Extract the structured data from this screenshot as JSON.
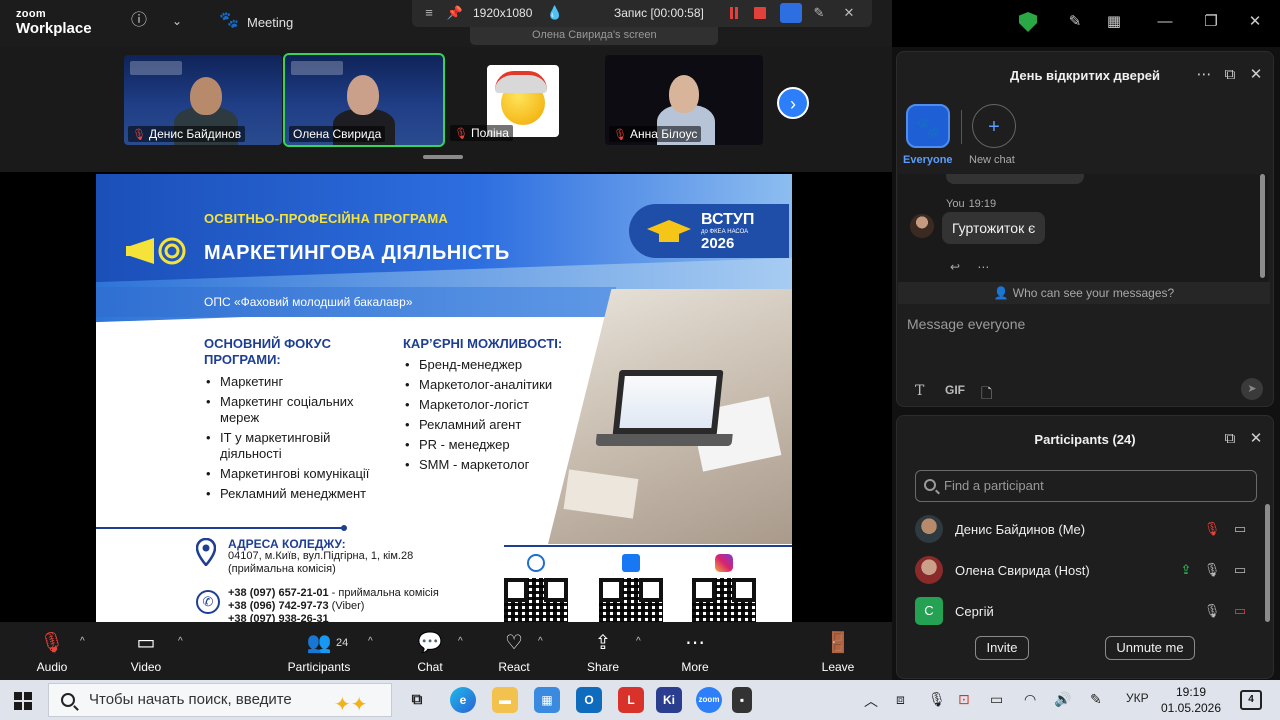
{
  "app": {
    "logo_line1": "zoom",
    "logo_line2": "Workplace",
    "meeting_label": "Meeting"
  },
  "recording_bar": {
    "resolution": "1920x1080",
    "recording": "Запис [00:00:58]",
    "sub_title": "Олена Свирида's screen"
  },
  "video_strip": {
    "participants": [
      {
        "name": "Денис Байдинов",
        "muted": true
      },
      {
        "name": "Олена Свирида",
        "muted": false,
        "active": true
      },
      {
        "name": "Поліна",
        "muted": true
      },
      {
        "name": "Анна Білоус",
        "muted": true
      }
    ]
  },
  "slide": {
    "program": "ОСВІТНЬО-ПРОФЕСІЙНА ПРОГРАМА",
    "title": "МАРКЕТИНГОВА ДІЯЛЬНІСТЬ",
    "vstup_title": "ВСТУП",
    "vstup_sub": "до ФКЕА НАСОА",
    "vstup_year": "2026",
    "ops": "ОПС «Фаховий молодший бакалавр»",
    "focus_heading": "ОСНОВНИЙ ФОКУС ПРОГРАМИ:",
    "focus_items": [
      "Маркетинг",
      "Маркетинг соціальних мереж",
      "ІТ у маркетинговій діяльності",
      "Маркетингові комунікації",
      "Рекламний менеджмент"
    ],
    "career_heading": "КАР’ЄРНІ МОЖЛИВОСТІ:",
    "career_items": [
      "Бренд-менеджер",
      "Маркетолог-аналітики",
      "Маркетолог-логіст",
      "Рекламний агент",
      "PR - менеджер",
      "SMM - маркетолог"
    ],
    "address_heading": "АДРЕСА КОЛЕДЖУ:",
    "address": "04107, м.Київ, вул.Підгірна, 1, кім.28 (приймальна комісія)",
    "phones": [
      {
        "number": "+38 (097) 657-21-01",
        "note": " - приймальна комісія"
      },
      {
        "number": "+38 (096) 742-97-73",
        "note": " (Viber)"
      },
      {
        "number": "+38 (097) 938-26-31",
        "note": ""
      }
    ]
  },
  "toolbar": {
    "audio": "Audio",
    "video": "Video",
    "participants": "Participants",
    "participants_count": "24",
    "chat": "Chat",
    "react": "React",
    "share": "Share",
    "more": "More",
    "leave": "Leave"
  },
  "chat": {
    "title": "День відкритих дверей",
    "everyone_label": "Everyone",
    "new_chat_label": "New chat",
    "message": {
      "sender": "You",
      "time": "19:19",
      "text": "Гуртожиток є"
    },
    "who_can_see": "Who can see your messages?",
    "input_placeholder": "Message everyone",
    "gif_label": "GIF"
  },
  "participants_panel": {
    "title": "Participants (24)",
    "search_placeholder": "Find a participant",
    "rows": [
      {
        "name": "Денис Байдинов (Me)",
        "mic_muted": true,
        "video_on": false
      },
      {
        "name": "Олена Свирида (Host)",
        "mic_muted": false,
        "sharing": true
      },
      {
        "name": "Сергій",
        "initial": "С",
        "mic_muted": false,
        "video_off": true
      }
    ],
    "invite_label": "Invite",
    "unmute_label": "Unmute me"
  },
  "taskbar": {
    "search_placeholder": "Чтобы начать поиск, введите",
    "lang": "УКР",
    "time": "19:19",
    "date": "01.05.2026",
    "notifications": "4"
  },
  "colors": {
    "accent_blue": "#2d7ff9",
    "active_green": "#36d45a",
    "muted_red": "#e8453c",
    "slide_navy": "#1e3e94"
  }
}
